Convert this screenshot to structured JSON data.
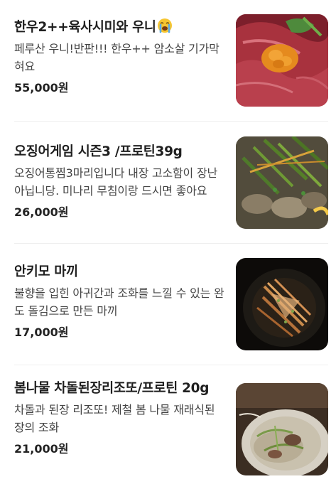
{
  "menu": {
    "items": [
      {
        "name": "한우2++육사시미와 우니",
        "icon": "crying-face-icon",
        "description": "페루산 우니!반판!!! 한우++ 암소살 기가막혀요",
        "price": "55,000원",
        "photo": "hanwoo-yukhoe-uni-photo"
      },
      {
        "name": "오징어게임 시즌3 /프로틴39g",
        "description": "오징어통찜3마리입니다 내장 고소함이 장난아닙니당. 미나리 무침이랑 드시면 좋아요",
        "price": "26,000원",
        "photo": "squid-dish-photo"
      },
      {
        "name": "안키모 마끼",
        "description": "불향을 입힌 아귀간과 조화를 느낄 수 있는 완도 돌김으로 만든 마끼",
        "price": "17,000원",
        "photo": "ankimo-maki-photo"
      },
      {
        "name": "봄나물 차돌된장리조또/프로틴 20g",
        "description": "차돌과 된장 리조또! 제철 봄 나물 재래식된장의 조화",
        "price": "21,000원",
        "photo": "risotto-photo"
      }
    ]
  },
  "colors": {
    "title": "#1f1f1f",
    "description": "#444444",
    "price": "#222222",
    "divider": "#eeeeee",
    "background": "#ffffff"
  }
}
